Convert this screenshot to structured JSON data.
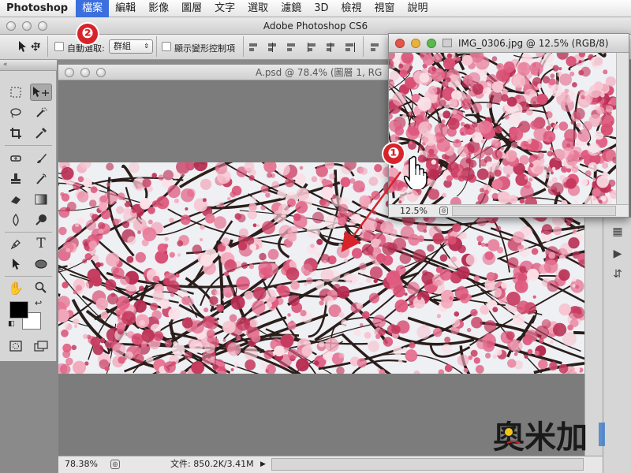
{
  "menubar": {
    "app": "Photoshop",
    "items": [
      "檔案",
      "編輯",
      "影像",
      "圖層",
      "文字",
      "選取",
      "濾鏡",
      "3D",
      "檢視",
      "視窗",
      "說明"
    ],
    "active_index": 0
  },
  "app_window": {
    "title": "Adobe Photoshop CS6"
  },
  "options_bar": {
    "auto_select_label": "自動選取:",
    "auto_select_value": "群組",
    "show_transform_label": "顯示變形控制項"
  },
  "document": {
    "title": "A.psd @ 78.4% (圖層 1, RG",
    "zoom": "78.38%",
    "file_info": "文件: 850.2K/3.41M"
  },
  "image_window": {
    "title": "IMG_0306.jpg @ 12.5% (RGB/8)",
    "zoom": "12.5%"
  },
  "annotations": {
    "badge_1": "❶",
    "badge_2": "❷",
    "arrow_color": "#d8232a"
  },
  "watermark": {
    "text": "奧米加"
  },
  "colors": {
    "menu_highlight": "#3a6fdd",
    "foreground": "#000000",
    "background": "#ffffff",
    "annotation_red": "#d8232a",
    "blossom_pink": "#e77896"
  },
  "icons": [
    "move-tool-icon",
    "marquee-tool-icon",
    "lasso-tool-icon",
    "quick-select-icon",
    "crop-icon",
    "eyedropper-icon",
    "healing-brush-icon",
    "brush-icon",
    "clone-stamp-icon",
    "history-brush-icon",
    "eraser-icon",
    "gradient-icon",
    "blur-icon",
    "dodge-icon",
    "pen-tool-icon",
    "type-tool-icon",
    "path-select-icon",
    "ellipse-tool-icon",
    "hand-tool-icon",
    "zoom-tool-icon",
    "color-swatches",
    "quick-mask-icon",
    "screen-mode-icon",
    "hand-cursor-icon"
  ]
}
